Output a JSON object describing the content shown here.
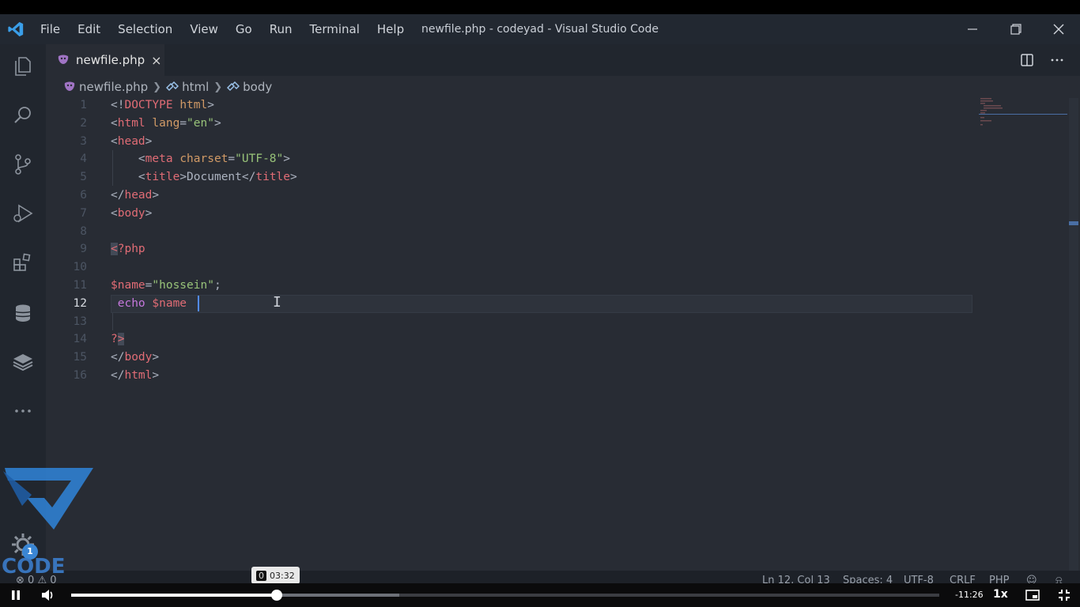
{
  "titlebar": {
    "menu": [
      "File",
      "Edit",
      "Selection",
      "View",
      "Go",
      "Run",
      "Terminal",
      "Help"
    ],
    "window_title": "newfile.php - codeyad - Visual Studio Code"
  },
  "activity_bar": [
    "files-icon",
    "search-icon",
    "source-control-icon",
    "run-debug-icon",
    "extensions-icon",
    "database-icon",
    "layers-icon",
    "more-icon"
  ],
  "tab": {
    "label": "newfile.php",
    "close": "×"
  },
  "breadcrumb": {
    "file": "newfile.php",
    "item1": "html",
    "item2": "body"
  },
  "editor": {
    "current_line": 12,
    "line_numbers": [
      "1",
      "2",
      "3",
      "4",
      "5",
      "6",
      "7",
      "8",
      "9",
      "10",
      "11",
      "12",
      "13",
      "14",
      "15",
      "16"
    ]
  },
  "statusbar": {
    "errors": "0",
    "warnings": "0",
    "position": "Ln 12, Col 13",
    "spaces": "Spaces: 4",
    "encoding": "UTF-8",
    "eol": "CRLF",
    "language": "PHP"
  },
  "watermark": {
    "brand": "CODE",
    "badge": "1"
  },
  "player": {
    "hover_time": "03:32",
    "hover_time_prefix": "0",
    "remaining": "-11:26",
    "speed": "1x",
    "progress_played": 0.237,
    "progress_buffered": 0.378
  }
}
